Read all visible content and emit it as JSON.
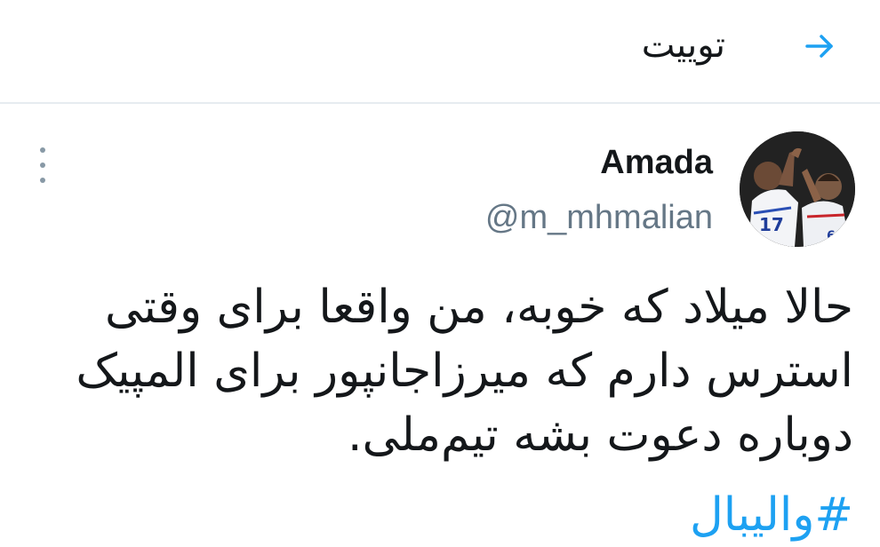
{
  "header": {
    "title": "توییت",
    "back_icon": "arrow-right-icon"
  },
  "tweet": {
    "author": {
      "display_name": "Amada",
      "handle": "@m_mhmalian",
      "avatar_description_icon": "avatar-image"
    },
    "text_lines": [
      "حالا میلاد که خوبه، من واقعا برای وقتی",
      "استرس دارم که میرزاجانپور برای المپیک",
      "دوباره دعوت بشه تیم‌ملی."
    ],
    "hashtag": "#والیبال",
    "more_icon": "more-vertical-icon"
  },
  "colors": {
    "accent": "#1da1f2",
    "text": "#14171a",
    "secondary": "#657786",
    "divider": "#e6ecf0"
  }
}
